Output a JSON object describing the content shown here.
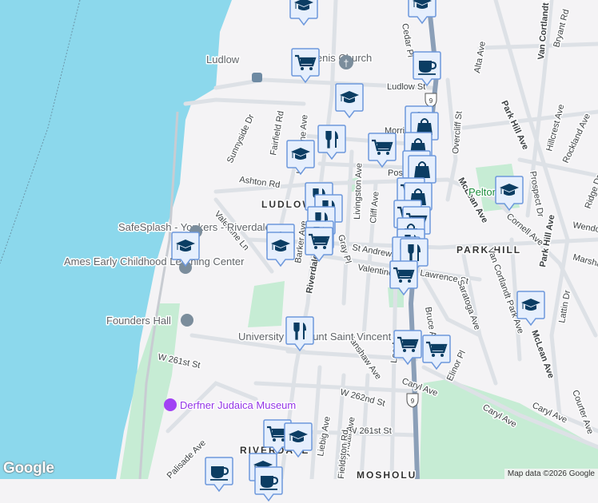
{
  "map": {
    "neighborhoods": [
      "LUDLOW",
      "PARK HILL"
    ],
    "streets": [
      "Ludlow St",
      "Ashton Rd",
      "Fairfield Rd",
      "Sunnyside Dr",
      "Hawthorne Ave",
      "Valentine Ln",
      "Valentine Ln",
      "St Andrews Pl",
      "Lawrence St",
      "Gray Pl",
      "Riverdale Ave",
      "Livingston Ave",
      "Cliff Ave",
      "Post St",
      "Morris St",
      "Cedar Pl",
      "Alta Ave",
      "Overcliff St",
      "Park Hill Ave",
      "Van Cortlandt Park Ave",
      "Bryant Rd",
      "Hillcrest Ave",
      "Rockland Ave",
      "Prospect Dr",
      "Cornell Ave",
      "Wendover Rd",
      "Marshall Rd",
      "Ridge Dr",
      "McLean Ave",
      "McLean Ave",
      "Park Hill Ave",
      "Saratoga Ave",
      "Van Cortlandt Park Ave",
      "Bruce Ave",
      "Elinor Pl",
      "Lattin Dr",
      "Courter Ave",
      "Caryl Ave",
      "Caryl Ave",
      "Caryl Ave",
      "Fanshaw Ave",
      "Lee Ave",
      "W 261st St",
      "W 262nd St",
      "W 261st St",
      "Liebig Ave",
      "Tyndall Ave",
      "Fieldston Rd",
      "Palisade Ave",
      "Barker Ave"
    ],
    "pois": {
      "st_denis": "St. Denis Church",
      "ludlow_station": "Ludlow",
      "safesplash": "SafeSplash - Yonkers - Riverdale",
      "ames": "Ames Early Childhood Learning Center",
      "founders": "Founders Hall",
      "umsv": "University of Mount Saint Vincent",
      "derfner": "Derfner Judaica Museum",
      "pelton": "Pelton Park",
      "riverdale": "RIVERDALE",
      "mosholu": "MOSHOLU"
    },
    "route_shield": "9",
    "attribution": "Map data ©2026 Google",
    "logo": "Google",
    "colors": {
      "water": "#8cd8ec",
      "land": "#f4f3f5",
      "park": "#c6ecd4",
      "highway": "#8b9fb8",
      "marker_fill": "#e6effd",
      "marker_border": "#6d98dc",
      "marker_icon": "#0b3d63"
    }
  }
}
